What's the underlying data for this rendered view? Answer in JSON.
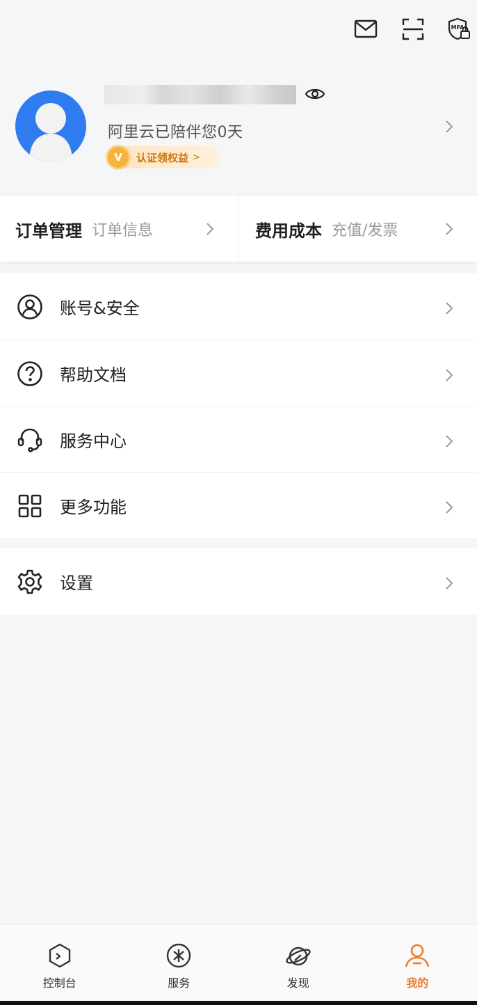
{
  "header": {
    "icons": [
      "mail-icon",
      "scan-icon",
      "mfa-icon"
    ],
    "mfa_label": "MFA"
  },
  "profile": {
    "companion_text": "阿里云已陪伴您0天",
    "badge_letter": "V",
    "badge_text": "认证领权益",
    "badge_arrow": ">"
  },
  "quick_links": [
    {
      "title": "订单管理",
      "subtitle": "订单信息"
    },
    {
      "title": "费用成本",
      "subtitle": "充值/发票"
    }
  ],
  "menu_main": [
    {
      "label": "账号&安全",
      "icon": "user-circle-icon"
    },
    {
      "label": "帮助文档",
      "icon": "help-circle-icon"
    },
    {
      "label": "服务中心",
      "icon": "headset-icon"
    },
    {
      "label": "更多功能",
      "icon": "grid-icon"
    }
  ],
  "menu_settings": [
    {
      "label": "设置",
      "icon": "gear-icon"
    }
  ],
  "tabbar": {
    "tabs": [
      {
        "label": "控制台",
        "icon": "console-icon",
        "active": false
      },
      {
        "label": "服务",
        "icon": "service-icon",
        "active": false
      },
      {
        "label": "发现",
        "icon": "planet-icon",
        "active": false
      },
      {
        "label": "我的",
        "icon": "person-icon",
        "active": true
      }
    ]
  },
  "colors": {
    "accent": "#f07d28",
    "avatar_bg": "#2f7cf0",
    "badge_text": "#c9760e",
    "page_bg": "#f5f6f8"
  }
}
